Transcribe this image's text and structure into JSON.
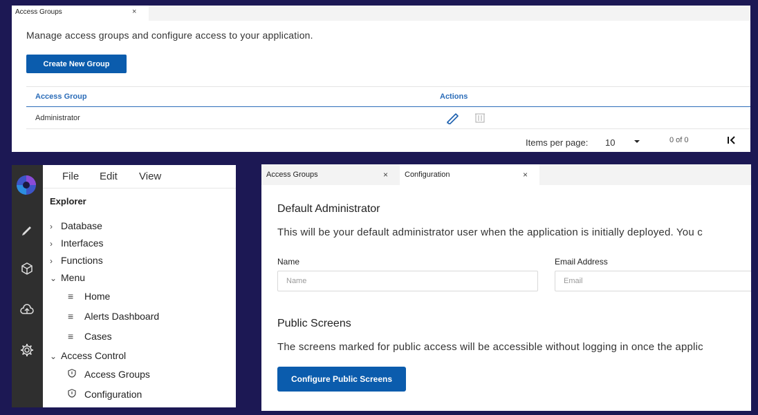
{
  "top_panel": {
    "tab": {
      "label": "Access Groups",
      "close": "×"
    },
    "description": "Manage access groups and configure access to your application.",
    "create_button": "Create New Group",
    "table": {
      "headers": [
        "Access Group",
        "Actions"
      ],
      "rows": [
        {
          "name": "Administrator"
        }
      ]
    },
    "pagination": {
      "items_per_page_label": "Items per page:",
      "items_per_page_value": "10",
      "range": "0 of 0"
    }
  },
  "ide": {
    "menu": [
      "File",
      "Edit",
      "View"
    ],
    "explorer_title": "Explorer",
    "tree": {
      "database": "Database",
      "interfaces": "Interfaces",
      "functions": "Functions",
      "menu": "Menu",
      "home": "Home",
      "alerts_dashboard": "Alerts Dashboard",
      "cases": "Cases",
      "access_control": "Access Control",
      "access_groups": "Access Groups",
      "configuration": "Configuration"
    },
    "activity_icons": [
      "logo-icon",
      "pencil-icon",
      "cube-icon",
      "cloud-upload-icon",
      "gear-icon"
    ]
  },
  "config_panel": {
    "tabs": [
      {
        "label": "Access Groups",
        "close": "×"
      },
      {
        "label": "Configuration",
        "close": "×"
      }
    ],
    "default_admin": {
      "heading": "Default Administrator",
      "description": "This will be your default administrator user when the application is initially deployed. You c",
      "name_label": "Name",
      "name_placeholder": "Name",
      "email_label": "Email Address",
      "email_placeholder": "Email"
    },
    "public_screens": {
      "heading": "Public Screens",
      "description": "The screens marked for public access will be accessible without logging in once the applic",
      "button": "Configure Public Screens"
    }
  },
  "colors": {
    "background": "#1c1854",
    "primary": "#0b5cad",
    "link": "#2b6cb8",
    "activity_bar": "#2f2f2f"
  }
}
